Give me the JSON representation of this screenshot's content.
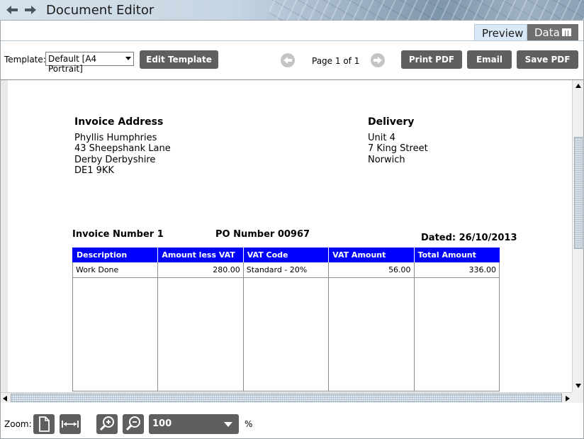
{
  "window": {
    "title": "Document Editor"
  },
  "tabs": {
    "preview": "Preview",
    "data": "Data",
    "data_icon": "grid-icon"
  },
  "toolbar": {
    "template_label": "Template:",
    "template_value": "Default [A4 Portrait]",
    "edit_template": "Edit Template",
    "page_indicator": "Page 1 of 1",
    "print_pdf": "Print PDF",
    "email": "Email",
    "save_pdf": "Save PDF"
  },
  "document": {
    "invoice_address": {
      "heading": "Invoice Address",
      "lines": [
        "Phyllis Humphries",
        "43 Sheepshank Lane",
        "Derby Derbyshire",
        "DE1 9KK"
      ]
    },
    "delivery": {
      "heading": "Delivery",
      "lines": [
        "Unit 4",
        "7 King Street",
        "Norwich"
      ]
    },
    "invoice_number": "Invoice Number 1",
    "po_number": "PO Number 00967",
    "dated": "Dated: 26/10/2013",
    "table": {
      "headers": [
        "Description",
        "Amount less VAT",
        "VAT Code",
        "VAT Amount",
        "Total Amount"
      ],
      "rows": [
        [
          "Work Done",
          "280.00",
          "Standard - 20%",
          "56.00",
          "336.00"
        ]
      ]
    }
  },
  "zoom": {
    "label": "Zoom:",
    "value": "100",
    "unit": "%"
  },
  "colors": {
    "table_header": "#0000ff",
    "button": "#5f5f5f",
    "tab_active": "#d9e9f7"
  }
}
